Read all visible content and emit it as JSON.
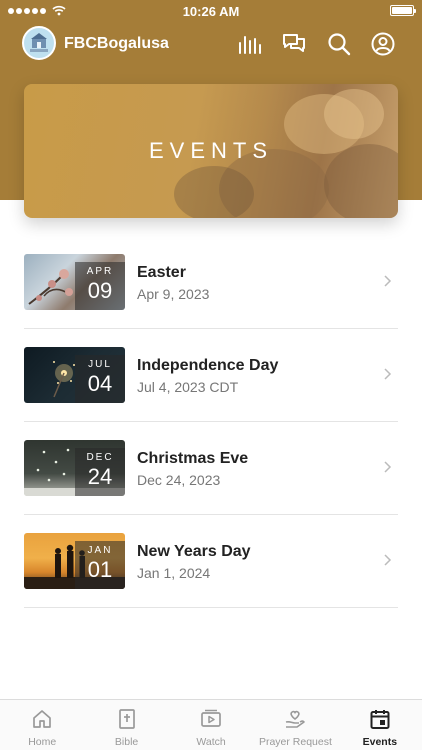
{
  "status_bar": {
    "time": "10:26 AM"
  },
  "app": {
    "name": "FBCBogalusa",
    "brand_color": "#a57d38"
  },
  "top_icons": [
    "equalizer-icon",
    "chat-icon",
    "search-icon",
    "account-icon"
  ],
  "hero": {
    "title": "EVENTS"
  },
  "events": [
    {
      "title": "Easter",
      "date": "Apr 9, 2023",
      "month": "APR",
      "day": "09"
    },
    {
      "title": "Independence Day",
      "date": "Jul 4, 2023 CDT",
      "month": "JUL",
      "day": "04"
    },
    {
      "title": "Christmas Eve",
      "date": "Dec 24, 2023",
      "month": "DEC",
      "day": "24"
    },
    {
      "title": "New Years Day",
      "date": "Jan 1, 2024",
      "month": "JAN",
      "day": "01"
    }
  ],
  "tabs": [
    {
      "label": "Home",
      "icon": "home-icon",
      "active": false
    },
    {
      "label": "Bible",
      "icon": "bible-icon",
      "active": false
    },
    {
      "label": "Watch",
      "icon": "watch-icon",
      "active": false
    },
    {
      "label": "Prayer Request",
      "icon": "prayer-icon",
      "active": false
    },
    {
      "label": "Events",
      "icon": "calendar-icon",
      "active": true
    }
  ]
}
